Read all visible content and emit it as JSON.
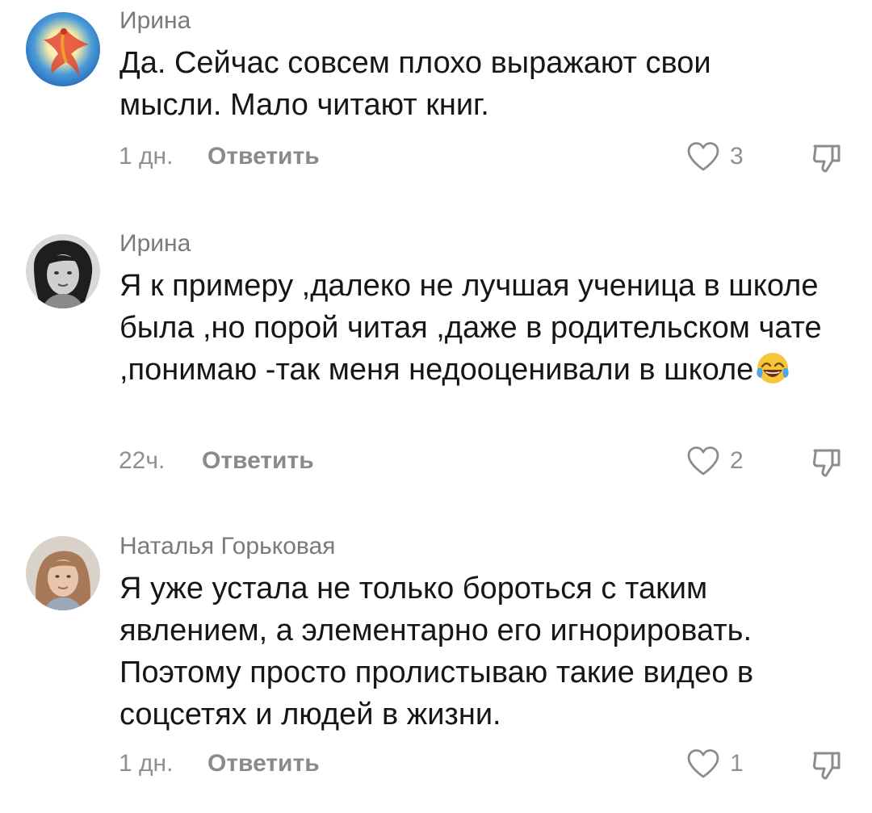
{
  "comments": [
    {
      "author": "Ирина",
      "text": "Да. Сейчас совсем плохо выражают свои мысли. Мало читают книг.",
      "time": "1 дн.",
      "reply_label": "Ответить",
      "likes": "3",
      "avatar_icon": "phoenix-avatar"
    },
    {
      "author": "Ирина",
      "text": "Я к примеру ,далеко не лучшая ученица в школе была ,но порой читая ,даже в родительском чате ,понимаю -так меня недооценивали в школе",
      "emoji": "face-with-tears-of-joy",
      "time": "22ч.",
      "reply_label": "Ответить",
      "likes": "2",
      "avatar_icon": "portrait-bw-avatar"
    },
    {
      "author": "Наталья Горьковая",
      "text": "Я уже устала не только бороться с таким явлением, а элементарно его игнорировать. Поэтому просто пролистываю такие видео в соцсетях и людей в жизни.",
      "time": "1 дн.",
      "reply_label": "Ответить",
      "likes": "1",
      "avatar_icon": "portrait-color-avatar"
    }
  ],
  "colors": {
    "text": "#161616",
    "author": "#7a7a7a",
    "meta": "#8f8f8f",
    "reply": "#8a8a8a",
    "icon": "#8c8c8c"
  }
}
